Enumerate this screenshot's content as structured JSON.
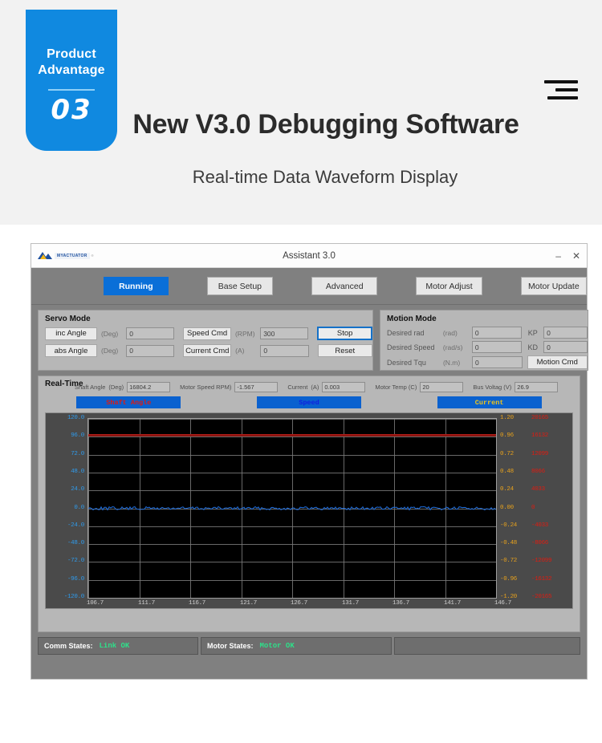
{
  "hero": {
    "badge_line1": "Product",
    "badge_line2": "Advantage",
    "badge_number": "03",
    "title": "New V3.0 Debugging Software",
    "subtitle": "Real-time Data Waveform Display",
    "menu_icon": "hamburger-menu-icon"
  },
  "window": {
    "logo_text": "MYACTUATOR",
    "logo_registered": "®",
    "title": "Assistant 3.0",
    "minimize": "–",
    "close": "✕"
  },
  "tabs": [
    {
      "label": "Running",
      "active": true
    },
    {
      "label": "Base Setup",
      "active": false
    },
    {
      "label": "Advanced",
      "active": false
    },
    {
      "label": "Motor Adjust",
      "active": false
    },
    {
      "label": "Motor Update",
      "active": false
    }
  ],
  "servo_mode": {
    "title": "Servo Mode",
    "rows": [
      {
        "button": "inc Angle",
        "unit": "(Deg)",
        "value": "0",
        "cmd_button": "Speed Cmd",
        "cmd_unit": "(RPM)",
        "cmd_value": "300",
        "action": "Stop"
      },
      {
        "button": "abs Angle",
        "unit": "(Deg)",
        "value": "0",
        "cmd_button": "Current Cmd",
        "cmd_unit": "(A)",
        "cmd_value": "0",
        "action": "Reset"
      }
    ]
  },
  "motion_mode": {
    "title": "Motion Mode",
    "rows": [
      {
        "label": "Desired rad",
        "unit": "(rad)",
        "value": "0",
        "gain_label": "KP",
        "gain_value": "0"
      },
      {
        "label": "Desired Speed",
        "unit": "(rad/s)",
        "value": "0",
        "gain_label": "KD",
        "gain_value": "0"
      },
      {
        "label": "Desired Tqu",
        "unit": "(N.m)",
        "value": "0",
        "gain_label": "",
        "gain_value": ""
      }
    ],
    "action": "Motion Cmd"
  },
  "real_time": {
    "title": "Real-Time",
    "fields": [
      {
        "label": "Shaft Angle",
        "unit": "(Deg)",
        "value": "16804.2"
      },
      {
        "label": "Motor Speed RPM)",
        "unit": "",
        "value": "-1.567"
      },
      {
        "label": "Current",
        "unit": "(A)",
        "value": "0.003"
      },
      {
        "label": "Motor Temp (C)",
        "unit": "",
        "value": "20"
      },
      {
        "label": "Bus Voltag (V)",
        "unit": "",
        "value": "26.9"
      }
    ],
    "legend_buttons": [
      {
        "label": "Shaft Angle",
        "color": "#e01b10",
        "bg": "#0a61cf"
      },
      {
        "label": "Speed",
        "color": "#1120e0",
        "bg": "#0a61cf"
      },
      {
        "label": "Current",
        "color": "#f0c419",
        "bg": "#0a61cf"
      }
    ]
  },
  "status_bar": {
    "comm_label": "Comm States:",
    "comm_value": "Link OK",
    "comm_color": "#2ee08a",
    "motor_label": "Motor States:",
    "motor_value": "Motor OK",
    "motor_color": "#2ee08a"
  },
  "chart_data": {
    "type": "line",
    "title": "Real-time Data Waveform Display",
    "xlabel": "",
    "ylabel": "",
    "grid": true,
    "legend_position": "top",
    "x": [
      106.7,
      111.7,
      116.7,
      121.7,
      126.7,
      131.7,
      136.7,
      141.7,
      146.7
    ],
    "xlim": [
      106.7,
      146.7
    ],
    "xtick_step": 5.0,
    "axes": [
      {
        "name": "Shaft Angle",
        "unit": "Deg",
        "color": "#2f9bec",
        "side": "left",
        "ticks": [
          120.0,
          96.0,
          72.0,
          48.0,
          24.0,
          0.0,
          -24.0,
          -48.0,
          -72.0,
          -96.0,
          -120.0
        ],
        "ylim": [
          -120.0,
          120.0
        ],
        "tick_step": 24.0
      },
      {
        "name": "Current",
        "unit": "A",
        "color": "#e8a21c",
        "side": "right-inner",
        "ticks": [
          1.2,
          0.96,
          0.72,
          0.48,
          0.24,
          0.0,
          -0.24,
          -0.48,
          -0.72,
          -0.96,
          -1.2
        ],
        "ylim": [
          -1.2,
          1.2
        ],
        "tick_step": 0.24
      },
      {
        "name": "Speed",
        "unit": "RPM",
        "color": "#e01b10",
        "side": "right-outer",
        "ticks": [
          20165,
          16132,
          12099,
          8066,
          4033,
          0,
          -4033,
          -8066,
          -12099,
          -16132,
          -20165
        ],
        "ylim": [
          -20165,
          20165
        ],
        "tick_step": 4033
      }
    ],
    "series": [
      {
        "name": "Shaft Angle",
        "color": "#8d1410",
        "axis": "Shaft Angle",
        "style": "flat-line",
        "approx_value": 97.0,
        "description": "Near-constant horizontal trace just above the 96.0 gridline"
      },
      {
        "name": "Speed",
        "color": "#1f6fe0",
        "axis": "Shaft Angle",
        "style": "noisy-line",
        "approx_value": 0.0,
        "noise_amplitude": 4.0,
        "description": "Noisy trace oscillating around the 0.0 baseline"
      }
    ]
  }
}
